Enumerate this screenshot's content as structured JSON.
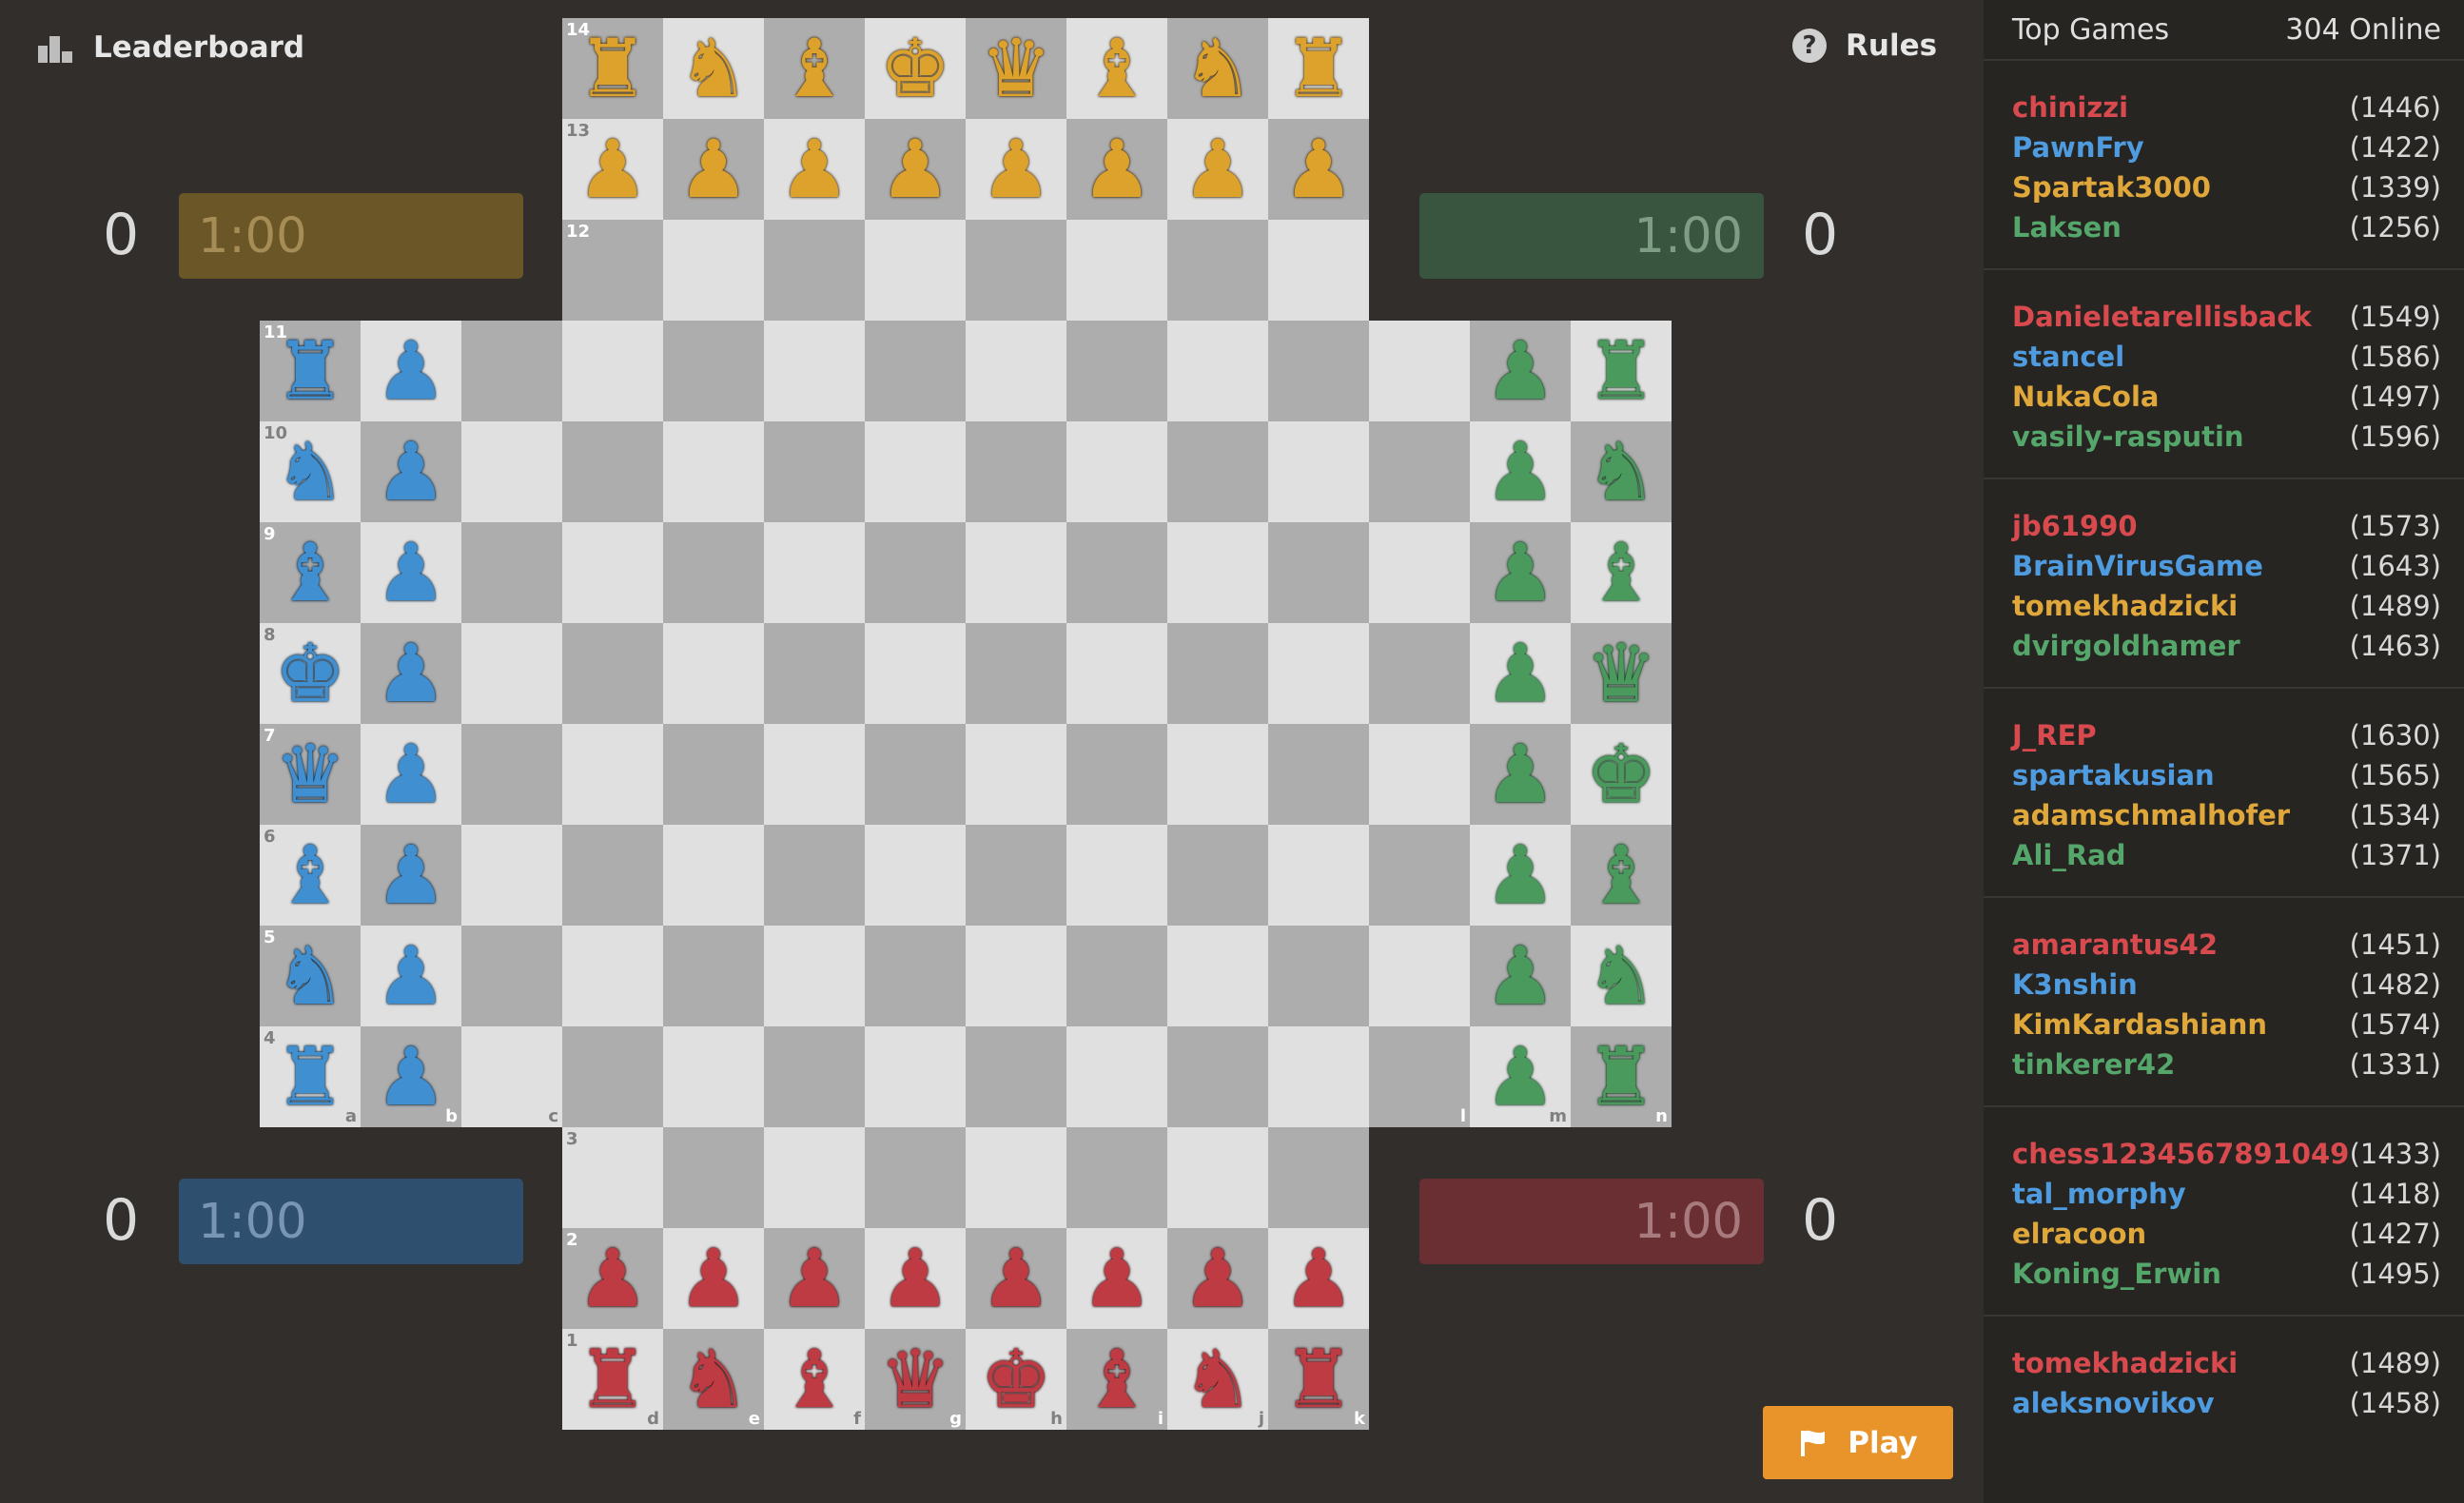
{
  "header": {
    "leaderboard_label": "Leaderboard",
    "rules_label": "Rules",
    "rules_icon_glyph": "?"
  },
  "players": {
    "yellow": {
      "score": "0",
      "clock": "1:00",
      "clock_bg": "#6b5628",
      "clock_fg": "#a58d55"
    },
    "green": {
      "score": "0",
      "clock": "1:00",
      "clock_bg": "#39543f",
      "clock_fg": "#7f9c84"
    },
    "blue": {
      "score": "0",
      "clock": "1:00",
      "clock_bg": "#2f4f6e",
      "clock_fg": "#7896b3"
    },
    "red": {
      "score": "0",
      "clock": "1:00",
      "clock_bg": "#6a2f33",
      "clock_fg": "#a77a7d"
    }
  },
  "board": {
    "files": [
      "a",
      "b",
      "c",
      "d",
      "e",
      "f",
      "g",
      "h",
      "i",
      "j",
      "k",
      "l",
      "m",
      "n"
    ],
    "ranks": [
      "1",
      "2",
      "3",
      "4",
      "5",
      "6",
      "7",
      "8",
      "9",
      "10",
      "11",
      "12",
      "13",
      "14"
    ],
    "light_square": "#e0e0e0",
    "dark_square": "#adadad",
    "piece_colors": {
      "yellow": "#dca22c",
      "red": "#bf3b43",
      "blue": "#3f8fd1",
      "green": "#4a9a5e"
    },
    "pieces": [
      {
        "sq": "d14",
        "c": "yellow",
        "t": "rook"
      },
      {
        "sq": "e14",
        "c": "yellow",
        "t": "knight"
      },
      {
        "sq": "f14",
        "c": "yellow",
        "t": "bishop"
      },
      {
        "sq": "g14",
        "c": "yellow",
        "t": "king"
      },
      {
        "sq": "h14",
        "c": "yellow",
        "t": "queen"
      },
      {
        "sq": "i14",
        "c": "yellow",
        "t": "bishop"
      },
      {
        "sq": "j14",
        "c": "yellow",
        "t": "knight"
      },
      {
        "sq": "k14",
        "c": "yellow",
        "t": "rook"
      },
      {
        "sq": "d13",
        "c": "yellow",
        "t": "pawn"
      },
      {
        "sq": "e13",
        "c": "yellow",
        "t": "pawn"
      },
      {
        "sq": "f13",
        "c": "yellow",
        "t": "pawn"
      },
      {
        "sq": "g13",
        "c": "yellow",
        "t": "pawn"
      },
      {
        "sq": "h13",
        "c": "yellow",
        "t": "pawn"
      },
      {
        "sq": "i13",
        "c": "yellow",
        "t": "pawn"
      },
      {
        "sq": "j13",
        "c": "yellow",
        "t": "pawn"
      },
      {
        "sq": "k13",
        "c": "yellow",
        "t": "pawn"
      },
      {
        "sq": "d1",
        "c": "red",
        "t": "rook"
      },
      {
        "sq": "e1",
        "c": "red",
        "t": "knight"
      },
      {
        "sq": "f1",
        "c": "red",
        "t": "bishop"
      },
      {
        "sq": "g1",
        "c": "red",
        "t": "queen"
      },
      {
        "sq": "h1",
        "c": "red",
        "t": "king"
      },
      {
        "sq": "i1",
        "c": "red",
        "t": "bishop"
      },
      {
        "sq": "j1",
        "c": "red",
        "t": "knight"
      },
      {
        "sq": "k1",
        "c": "red",
        "t": "rook"
      },
      {
        "sq": "d2",
        "c": "red",
        "t": "pawn"
      },
      {
        "sq": "e2",
        "c": "red",
        "t": "pawn"
      },
      {
        "sq": "f2",
        "c": "red",
        "t": "pawn"
      },
      {
        "sq": "g2",
        "c": "red",
        "t": "pawn"
      },
      {
        "sq": "h2",
        "c": "red",
        "t": "pawn"
      },
      {
        "sq": "i2",
        "c": "red",
        "t": "pawn"
      },
      {
        "sq": "j2",
        "c": "red",
        "t": "pawn"
      },
      {
        "sq": "k2",
        "c": "red",
        "t": "pawn"
      },
      {
        "sq": "a11",
        "c": "blue",
        "t": "rook"
      },
      {
        "sq": "a10",
        "c": "blue",
        "t": "knight"
      },
      {
        "sq": "a9",
        "c": "blue",
        "t": "bishop"
      },
      {
        "sq": "a8",
        "c": "blue",
        "t": "king"
      },
      {
        "sq": "a7",
        "c": "blue",
        "t": "queen"
      },
      {
        "sq": "a6",
        "c": "blue",
        "t": "bishop"
      },
      {
        "sq": "a5",
        "c": "blue",
        "t": "knight"
      },
      {
        "sq": "a4",
        "c": "blue",
        "t": "rook"
      },
      {
        "sq": "b11",
        "c": "blue",
        "t": "pawn"
      },
      {
        "sq": "b10",
        "c": "blue",
        "t": "pawn"
      },
      {
        "sq": "b9",
        "c": "blue",
        "t": "pawn"
      },
      {
        "sq": "b8",
        "c": "blue",
        "t": "pawn"
      },
      {
        "sq": "b7",
        "c": "blue",
        "t": "pawn"
      },
      {
        "sq": "b6",
        "c": "blue",
        "t": "pawn"
      },
      {
        "sq": "b5",
        "c": "blue",
        "t": "pawn"
      },
      {
        "sq": "b4",
        "c": "blue",
        "t": "pawn"
      },
      {
        "sq": "n11",
        "c": "green",
        "t": "rook"
      },
      {
        "sq": "n10",
        "c": "green",
        "t": "knight"
      },
      {
        "sq": "n9",
        "c": "green",
        "t": "bishop"
      },
      {
        "sq": "n8",
        "c": "green",
        "t": "queen"
      },
      {
        "sq": "n7",
        "c": "green",
        "t": "king"
      },
      {
        "sq": "n6",
        "c": "green",
        "t": "bishop"
      },
      {
        "sq": "n5",
        "c": "green",
        "t": "knight"
      },
      {
        "sq": "n4",
        "c": "green",
        "t": "rook"
      },
      {
        "sq": "m11",
        "c": "green",
        "t": "pawn"
      },
      {
        "sq": "m10",
        "c": "green",
        "t": "pawn"
      },
      {
        "sq": "m9",
        "c": "green",
        "t": "pawn"
      },
      {
        "sq": "m8",
        "c": "green",
        "t": "pawn"
      },
      {
        "sq": "m7",
        "c": "green",
        "t": "pawn"
      },
      {
        "sq": "m6",
        "c": "green",
        "t": "pawn"
      },
      {
        "sq": "m5",
        "c": "green",
        "t": "pawn"
      },
      {
        "sq": "m4",
        "c": "green",
        "t": "pawn"
      }
    ]
  },
  "panel": {
    "title": "Top Games",
    "online": "304 Online",
    "games": [
      [
        {
          "name": "chinizzi",
          "rating": "(1446)"
        },
        {
          "name": "PawnFry",
          "rating": "(1422)"
        },
        {
          "name": "Spartak3000",
          "rating": "(1339)"
        },
        {
          "name": "Laksen",
          "rating": "(1256)"
        }
      ],
      [
        {
          "name": "Danieletarellisback",
          "rating": "(1549)"
        },
        {
          "name": "stancel",
          "rating": "(1586)"
        },
        {
          "name": "NukaCola",
          "rating": "(1497)"
        },
        {
          "name": "vasily-rasputin",
          "rating": "(1596)"
        }
      ],
      [
        {
          "name": "jb61990",
          "rating": "(1573)"
        },
        {
          "name": "BrainVirusGame",
          "rating": "(1643)"
        },
        {
          "name": "tomekhadzicki",
          "rating": "(1489)"
        },
        {
          "name": "dvirgoldhamer",
          "rating": "(1463)"
        }
      ],
      [
        {
          "name": "J_REP",
          "rating": "(1630)"
        },
        {
          "name": "spartakusian",
          "rating": "(1565)"
        },
        {
          "name": "adamschmalhofer",
          "rating": "(1534)"
        },
        {
          "name": "Ali_Rad",
          "rating": "(1371)"
        }
      ],
      [
        {
          "name": "amarantus42",
          "rating": "(1451)"
        },
        {
          "name": "K3nshin",
          "rating": "(1482)"
        },
        {
          "name": "KimKardashiann",
          "rating": "(1574)"
        },
        {
          "name": "tinkerer42",
          "rating": "(1331)"
        }
      ],
      [
        {
          "name": "chess1234567891049",
          "rating": "(1433)"
        },
        {
          "name": "tal_morphy",
          "rating": "(1418)"
        },
        {
          "name": "elracoon",
          "rating": "(1427)"
        },
        {
          "name": "Koning_Erwin",
          "rating": "(1495)"
        }
      ],
      [
        {
          "name": "tomekhadzicki",
          "rating": "(1489)"
        },
        {
          "name": "aleksnovikov",
          "rating": "(1458)"
        },
        {
          "name": "",
          "rating": ""
        },
        {
          "name": "",
          "rating": ""
        }
      ]
    ]
  },
  "play_button": {
    "label": "Play",
    "color": "#e8942a"
  }
}
